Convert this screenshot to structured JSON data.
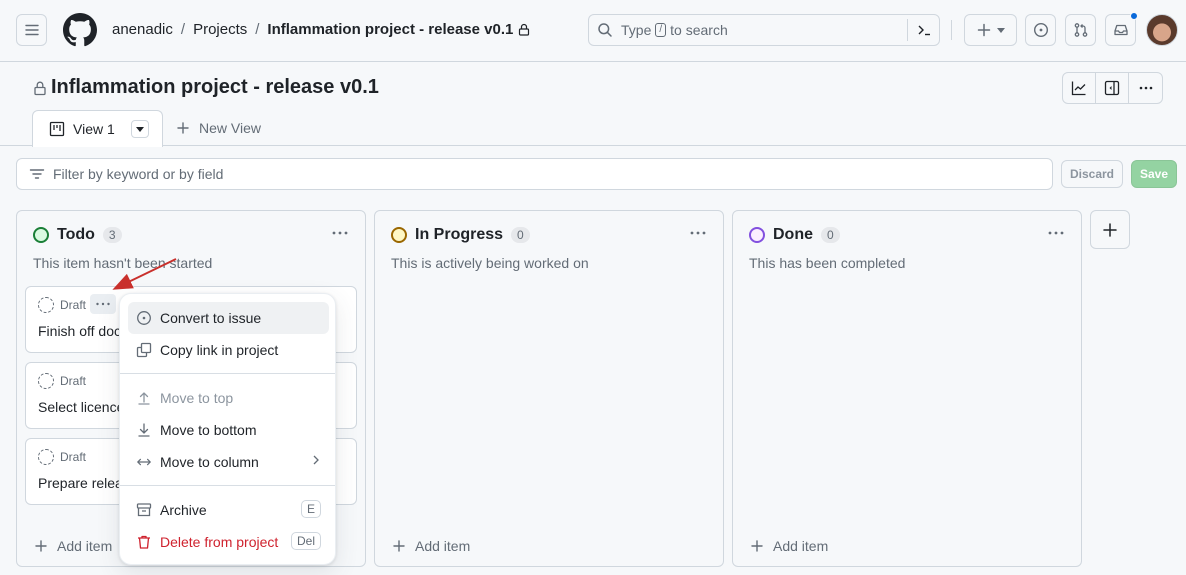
{
  "header": {
    "breadcrumb": [
      "anenadic",
      "Projects",
      "Inflammation project - release v0.1"
    ],
    "search": {
      "prefix": "Type",
      "key": "/",
      "suffix": "to search"
    },
    "notification_dot_color": "#0969da"
  },
  "project": {
    "title": "Inflammation project - release v0.1",
    "tabs": [
      {
        "label": "View 1",
        "icon": "table-board-icon",
        "active": true
      },
      {
        "label": "New View",
        "icon": "plus-icon",
        "active": false
      }
    ]
  },
  "filter": {
    "placeholder": "Filter by keyword or by field",
    "discard_label": "Discard",
    "save_label": "Save"
  },
  "columns": [
    {
      "name": "Todo",
      "count": "3",
      "color": "#1a7f37",
      "fill": "#dafbe1",
      "description": "This item hasn't been started",
      "cards": [
        {
          "type": "Draft",
          "title": "Finish off documentation"
        },
        {
          "type": "Draft",
          "title": "Select licence"
        },
        {
          "type": "Draft",
          "title": "Prepare release"
        }
      ],
      "add_label": "Add item"
    },
    {
      "name": "In Progress",
      "count": "0",
      "color": "#9a6700",
      "fill": "#fff8c5",
      "description": "This is actively being worked on",
      "cards": [],
      "add_label": "Add item"
    },
    {
      "name": "Done",
      "count": "0",
      "color": "#8250df",
      "fill": "#fbefff",
      "description": "This has been completed",
      "cards": [],
      "add_label": "Add item"
    }
  ],
  "context_menu": {
    "items": [
      {
        "label": "Convert to issue",
        "icon": "issue-opened-icon",
        "state": "active"
      },
      {
        "label": "Copy link in project",
        "icon": "copy-icon",
        "state": "normal"
      },
      {
        "label": "Move to top",
        "icon": "arrow-up-icon",
        "state": "disabled"
      },
      {
        "label": "Move to bottom",
        "icon": "arrow-down-icon",
        "state": "normal"
      },
      {
        "label": "Move to column",
        "icon": "arrow-both-icon",
        "state": "normal",
        "submenu": true
      },
      {
        "label": "Archive",
        "icon": "archive-icon",
        "state": "normal",
        "shortcut": "E"
      },
      {
        "label": "Delete from project",
        "icon": "trash-icon",
        "state": "danger",
        "shortcut": "Del"
      }
    ]
  }
}
